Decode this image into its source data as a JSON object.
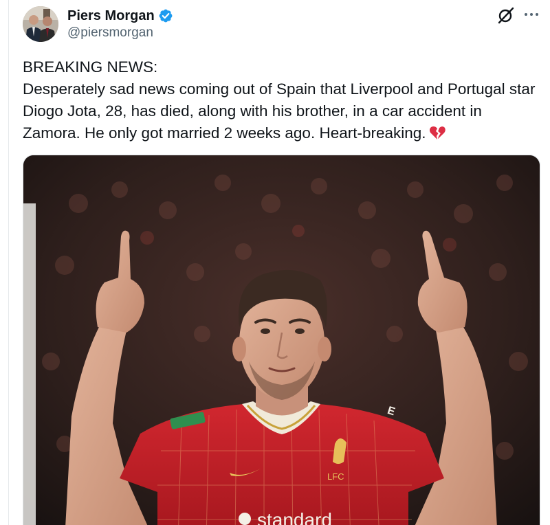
{
  "author": {
    "name": "Piers Morgan",
    "handle": "@piersmorgan",
    "verified": true,
    "verified_color": "#1d9bf0"
  },
  "header_actions": {
    "grok_icon": "grok-icon",
    "more_icon": "more-icon"
  },
  "tweet": {
    "text": "BREAKING NEWS:\nDesperately sad news coming out of Spain that Liverpool and Portugal star Diogo Jota, 28, has died, along with his brother, in a car accident in Zamora. He only got married 2 weeks ago. Heart-breaking.",
    "emoji": "broken-heart-emoji"
  },
  "media": {
    "shirt_crest_text": "LFC",
    "shirt_sponsor_text": "standard",
    "sleeve_text": "E"
  }
}
